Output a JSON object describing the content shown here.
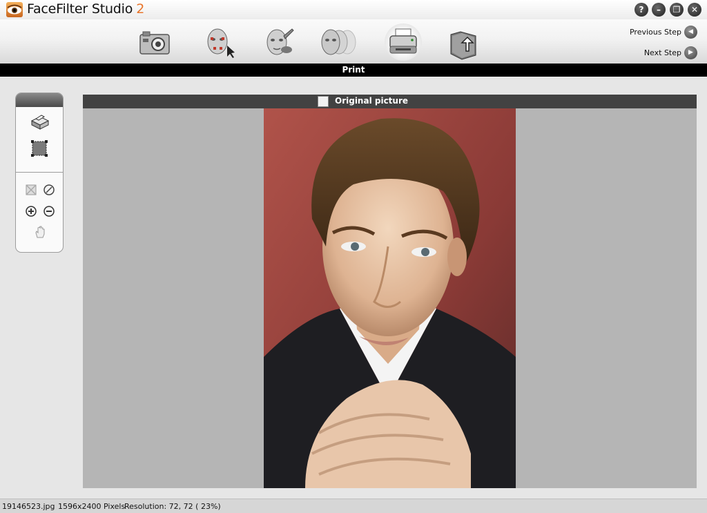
{
  "app": {
    "title": "FaceFilter Studio",
    "version": "2",
    "window_buttons": {
      "help": "?",
      "minimize": "–",
      "restore": "❐",
      "close": "✕"
    }
  },
  "toolbar": {
    "tools": [
      {
        "icon": "camera-icon"
      },
      {
        "icon": "face-select-icon"
      },
      {
        "icon": "face-edit-icon"
      },
      {
        "icon": "face-morph-icon"
      },
      {
        "icon": "printer-icon",
        "active": true
      },
      {
        "icon": "folder-return-icon"
      }
    ],
    "previous_step": "Previous Step",
    "next_step": "Next Step"
  },
  "section": {
    "title": "Print"
  },
  "preview": {
    "label": "Original picture",
    "checkbox_checked": false
  },
  "palette": {
    "icons": [
      "printer-small-icon",
      "crop-area-icon",
      "fit-view-icon",
      "no-zoom-icon",
      "zoom-in-icon",
      "zoom-out-icon",
      "hand-pan-icon"
    ]
  },
  "status": {
    "filename": "19146523.jpg",
    "dimensions": "1596x2400 Pixels",
    "resolution": "Resolution: 72, 72 ( 23%)"
  },
  "colors": {
    "section_bar": "#000000",
    "preview_header": "#424242",
    "canvas_bg": "#b5b5b5",
    "version_accent": "#e8742a"
  }
}
